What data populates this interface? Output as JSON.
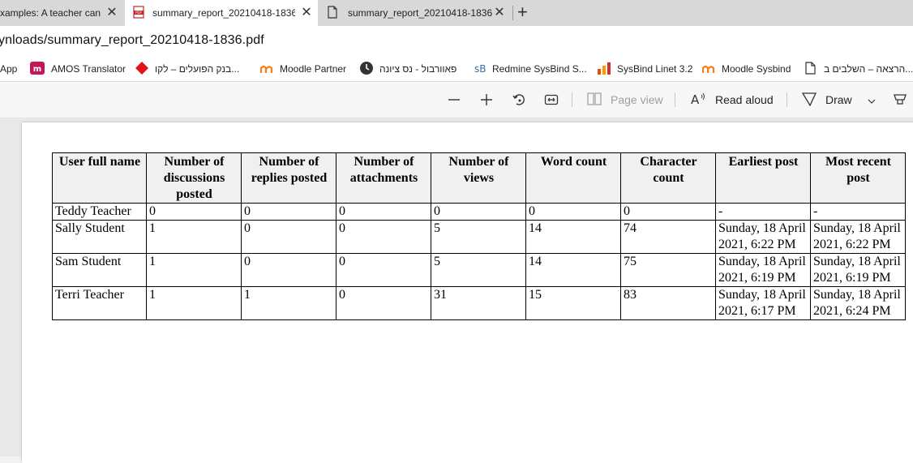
{
  "tabs": [
    {
      "label": "xamples: A teacher can",
      "active": false
    },
    {
      "label": "summary_report_20210418-1836",
      "active": true
    },
    {
      "label": "summary_report_20210418-1836",
      "active": false
    }
  ],
  "address": {
    "url": "ynloads/summary_report_20210418-1836.pdf"
  },
  "favorites": [
    {
      "label": "App"
    },
    {
      "label": "AMOS Translator"
    },
    {
      "label": "בנק הפועלים – לקו..."
    },
    {
      "label": "Moodle Partner"
    },
    {
      "label": "פאוורבול - נס ציונה"
    },
    {
      "label": "Redmine SysBind S..."
    },
    {
      "label": "SysBind Linet 3.2"
    },
    {
      "label": "Moodle Sysbind"
    },
    {
      "label": "הרצאה – השלבים ב..."
    }
  ],
  "toolbar": {
    "page_view": "Page view",
    "read_aloud": "Read aloud",
    "draw": "Draw"
  },
  "report": {
    "headers": [
      "User full name",
      "Number of discussions posted",
      "Number of replies posted",
      "Number of attachments",
      "Number of views",
      "Word count",
      "Character count",
      "Earliest post",
      "Most recent post"
    ],
    "rows": [
      [
        "Teddy Teacher",
        "0",
        "0",
        "0",
        "0",
        "0",
        "0",
        "-",
        "-"
      ],
      [
        "Sally Student",
        "1",
        "0",
        "0",
        "5",
        "14",
        "74",
        "Sunday, 18 April 2021, 6:22 PM",
        "Sunday, 18 April 2021, 6:22 PM"
      ],
      [
        "Sam Student",
        "1",
        "0",
        "0",
        "5",
        "14",
        "75",
        "Sunday, 18 April 2021, 6:19 PM",
        "Sunday, 18 April 2021, 6:19 PM"
      ],
      [
        "Terri Teacher",
        "1",
        "1",
        "0",
        "31",
        "15",
        "83",
        "Sunday, 18 April 2021, 6:17 PM",
        "Sunday, 18 April 2021, 6:24 PM"
      ]
    ]
  }
}
